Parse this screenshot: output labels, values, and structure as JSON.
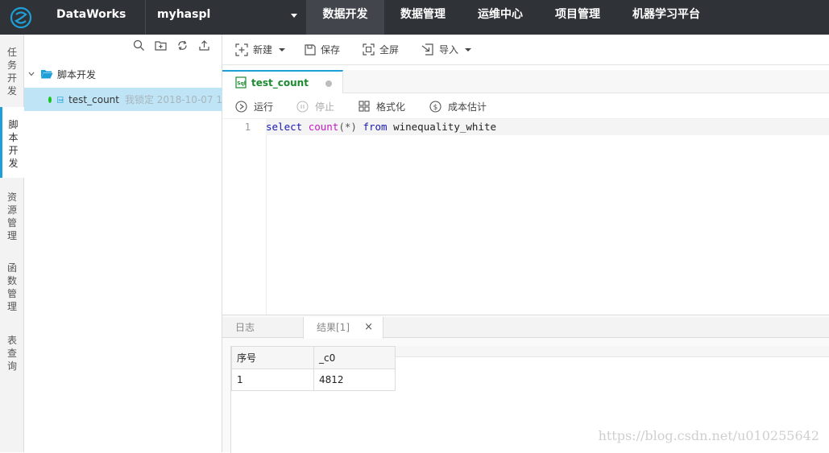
{
  "app": {
    "brand": "DataWorks",
    "project": "myhaspl"
  },
  "nav": [
    {
      "label": "数据开发",
      "active": true
    },
    {
      "label": "数据管理",
      "active": false
    },
    {
      "label": "运维中心",
      "active": false
    },
    {
      "label": "项目管理",
      "active": false
    },
    {
      "label": "机器学习平台",
      "active": false
    }
  ],
  "left_tabs": [
    {
      "label": "任务开发"
    },
    {
      "label": "脚本开发",
      "active": true
    },
    {
      "label": "资源管理"
    },
    {
      "label": "函数管理"
    },
    {
      "label": "表查询"
    }
  ],
  "tree": {
    "folder": "脚本开发",
    "file": {
      "name": "test_count",
      "lock": "我锁定 2018-10-07 1"
    }
  },
  "toolbar": {
    "new_label": "新建",
    "save_label": "保存",
    "fullscreen_label": "全屏",
    "import_label": "导入"
  },
  "file_tab": {
    "label": "test_count"
  },
  "exec": {
    "run_label": "运行",
    "stop_label": "停止",
    "format_label": "格式化",
    "cost_label": "成本估计"
  },
  "editor": {
    "line_number": "1",
    "tokens": {
      "select": "select",
      "count": "count",
      "paren": "(*)",
      "from": "from",
      "table": "winequality_white"
    }
  },
  "results": {
    "tab_log": "日志",
    "tab_result": "结果[1]",
    "close_glyph": "×",
    "columns": [
      "序号",
      "_c0"
    ],
    "rows": [
      [
        "1",
        "4812"
      ]
    ]
  },
  "watermark": "https://blog.csdn.net/u010255642",
  "colors": {
    "topbar": "#2f3237",
    "accent": "#1e9fd8",
    "selected_row": "#bfe4f6",
    "tab_text": "#1c8a2e"
  }
}
